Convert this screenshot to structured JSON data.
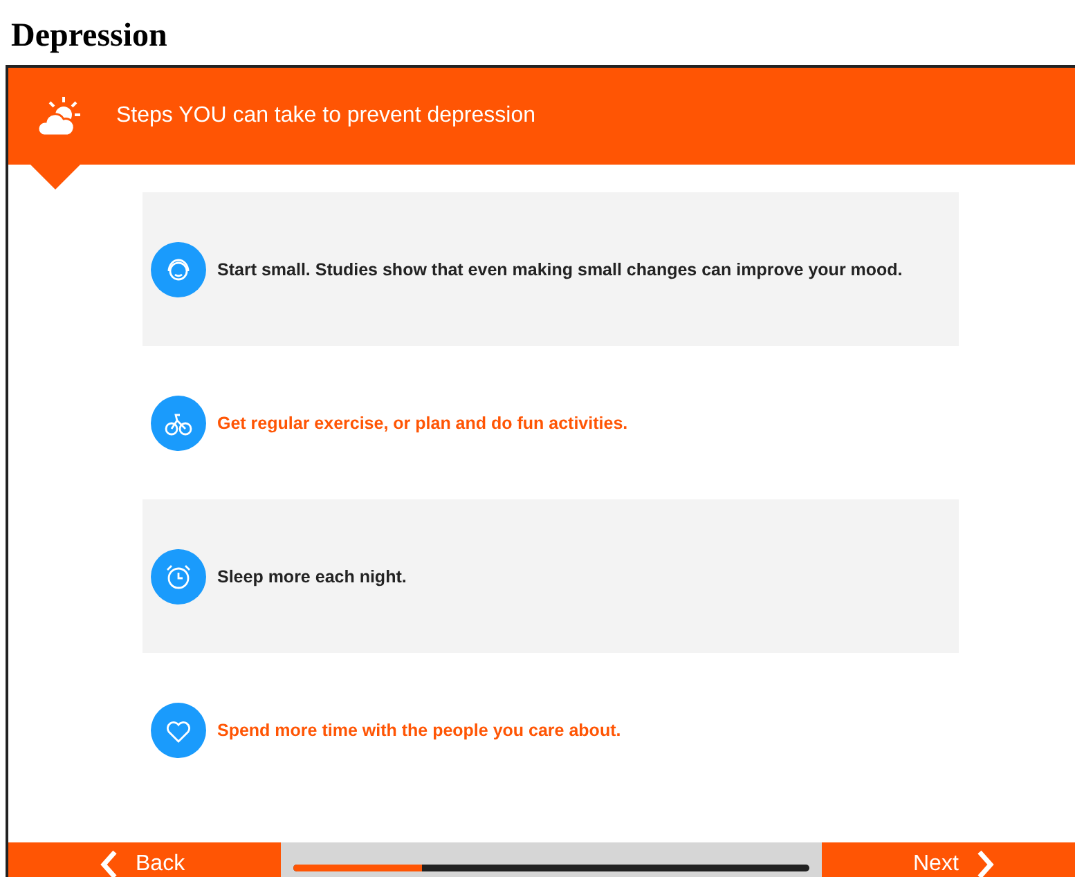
{
  "page_title": "Depression",
  "header": {
    "title": "Steps YOU can take to prevent depression"
  },
  "steps": [
    {
      "kind": "face",
      "text": "Start small. Studies show that even making small changes can improve your mood.",
      "shaded": true
    },
    {
      "kind": "bike",
      "text": "Get regular exercise, or plan and do fun activities.",
      "shaded": false
    },
    {
      "kind": "clock",
      "text": "Sleep more each night.",
      "shaded": true
    },
    {
      "kind": "heart",
      "text": "Spend more time with the people you care about.",
      "shaded": false
    }
  ],
  "footer": {
    "back": "Back",
    "next": "Next",
    "progress": {
      "level": 0.25
    }
  }
}
